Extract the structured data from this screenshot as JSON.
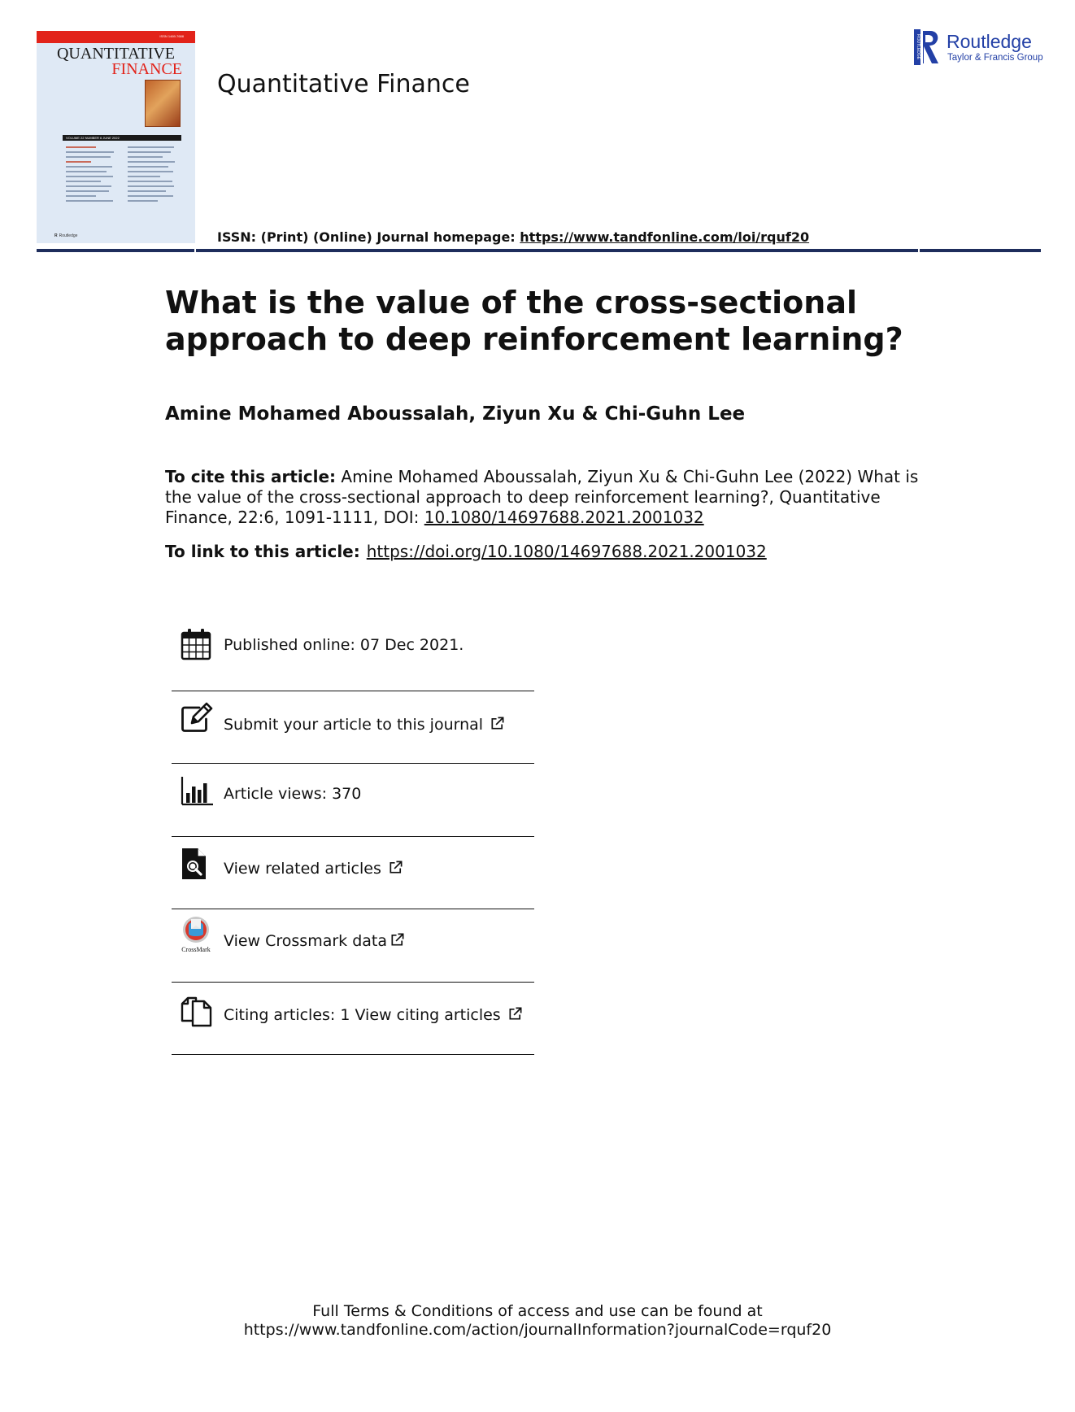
{
  "header": {
    "journal_name": "Quantitative Finance",
    "issn_label": "ISSN: (Print) (Online) Journal homepage: ",
    "homepage_url": "https://www.tandfonline.com/loi/rquf20",
    "cover": {
      "title_line1": "QUANTITATIVE",
      "title_line2": "FINANCE",
      "issn": "ISSN 1469-7688",
      "volume_bar": "VOLUME 22   NUMBER 6   JUNE 2022",
      "publisher": "Routledge"
    },
    "publisher_logo": {
      "name": "Routledge",
      "group": "Taylor & Francis Group"
    },
    "colors": {
      "rule": "#1e2d5c",
      "cover_red": "#e2231a",
      "logo_blue": "#2340a6"
    }
  },
  "article": {
    "title": "What is the value of the cross-sectional approach to deep reinforcement learning?",
    "authors": "Amine Mohamed Aboussalah, Ziyun Xu & Chi-Guhn Lee",
    "cite_label": "To cite this article:",
    "cite_text": " Amine Mohamed Aboussalah, Ziyun Xu & Chi-Guhn Lee (2022) What is the value of the cross-sectional approach to deep reinforcement learning?, Quantitative Finance, 22:6, 1091-1111, DOI: ",
    "cite_doi": "10.1080/14697688.2021.2001032",
    "link_label": "To link to this article:",
    "link_url": "https://doi.org/10.1080/14697688.2021.2001032"
  },
  "info": {
    "published": "Published online: 07 Dec 2021.",
    "submit": "Submit your article to this journal",
    "views": "Article views: 370",
    "related": "View related articles",
    "crossmark": "View Crossmark data",
    "crossmark_caption": "CrossMark",
    "citing": "Citing articles: 1 View citing articles"
  },
  "footer": {
    "line1": "Full Terms & Conditions of access and use can be found at",
    "line2": "https://www.tandfonline.com/action/journalInformation?journalCode=rquf20"
  }
}
